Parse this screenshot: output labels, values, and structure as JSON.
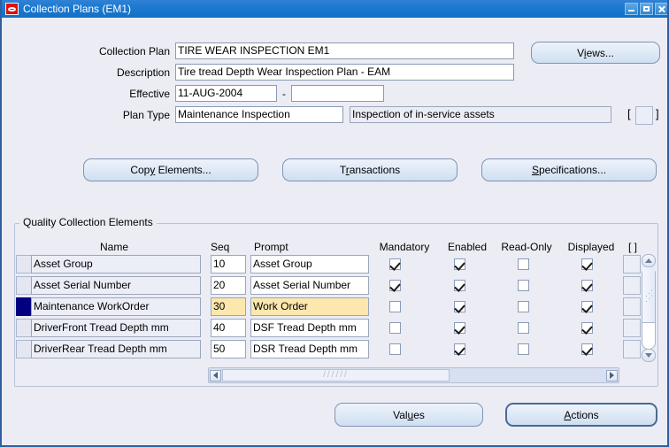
{
  "window": {
    "title": "Collection Plans (EM1)",
    "logo_icon": "oracle-logo-icon",
    "minimize_icon": "minimize-icon",
    "maximize_icon": "maximize-icon",
    "close_icon": "close-icon",
    "titlebar_color": "#1b79cf",
    "background_color": "#ECECF5"
  },
  "header": {
    "fields": [
      {
        "label": "Collection Plan",
        "value": "TIRE WEAR INSPECTION EM1"
      },
      {
        "label": "Description",
        "value": "Tire tread Depth Wear Inspection Plan - EAM"
      },
      {
        "label": "Effective",
        "value": "11-AUG-2004",
        "value_to": "",
        "separator": "-"
      },
      {
        "label": "Plan Type",
        "value": "Maintenance Inspection",
        "value_desc": "Inspection of in-service assets"
      }
    ],
    "views_button": "Views...",
    "views_mnemonic": "i",
    "flexfield_bracket_open": "[",
    "flexfield_bracket_close": "]"
  },
  "toolbar": {
    "buttons": [
      {
        "label": "Copy Elements...",
        "pre": "Cop",
        "mnemonic": "y",
        "post": " Elements..."
      },
      {
        "label": "Transactions",
        "pre": "T",
        "mnemonic": "r",
        "post": "ansactions"
      },
      {
        "label": "Specifications...",
        "pre": "",
        "mnemonic": "S",
        "post": "pecifications..."
      }
    ]
  },
  "elements_region": {
    "title": "Quality Collection Elements",
    "columns": [
      {
        "key": "name",
        "label": "Name"
      },
      {
        "key": "seq",
        "label": "Seq"
      },
      {
        "key": "prompt",
        "label": "Prompt"
      },
      {
        "key": "mandatory",
        "label": "Mandatory"
      },
      {
        "key": "enabled",
        "label": "Enabled"
      },
      {
        "key": "readonly",
        "label": "Read-Only"
      },
      {
        "key": "displayed",
        "label": "Displayed"
      },
      {
        "key": "flex",
        "label": "[ ]"
      }
    ],
    "rows": [
      {
        "name": "Asset Group",
        "seq": "10",
        "prompt": "Asset Group",
        "mandatory": true,
        "enabled": true,
        "readonly": false,
        "displayed": true,
        "selected": false
      },
      {
        "name": "Asset Serial Number",
        "seq": "20",
        "prompt": "Asset Serial Number",
        "mandatory": true,
        "enabled": true,
        "readonly": false,
        "displayed": true,
        "selected": false
      },
      {
        "name": "Maintenance WorkOrder",
        "seq": "30",
        "prompt": "Work Order",
        "mandatory": false,
        "enabled": true,
        "readonly": false,
        "displayed": true,
        "selected": true
      },
      {
        "name": "DriverFront Tread Depth mm",
        "seq": "40",
        "prompt": "DSF Tread Depth mm",
        "mandatory": false,
        "enabled": true,
        "readonly": false,
        "displayed": true,
        "selected": false
      },
      {
        "name": "DriverRear Tread Depth mm",
        "seq": "50",
        "prompt": "DSR Tread Depth mm",
        "mandatory": false,
        "enabled": true,
        "readonly": false,
        "displayed": true,
        "selected": false
      }
    ],
    "selected_row_color": "#000080",
    "highlight_color": "#FCE7AE",
    "scroll_up_icon": "scroll-up-arrow-icon",
    "scroll_down_icon": "scroll-down-arrow-icon",
    "scroll_left_icon": "scroll-left-arrow-icon",
    "scroll_right_icon": "scroll-right-arrow-icon"
  },
  "footer": {
    "values_button": {
      "label": "Values",
      "pre": "Val",
      "mnemonic": "u",
      "post": "es"
    },
    "actions_button": {
      "label": "Actions",
      "pre": "",
      "mnemonic": "A",
      "post": "ctions"
    }
  }
}
